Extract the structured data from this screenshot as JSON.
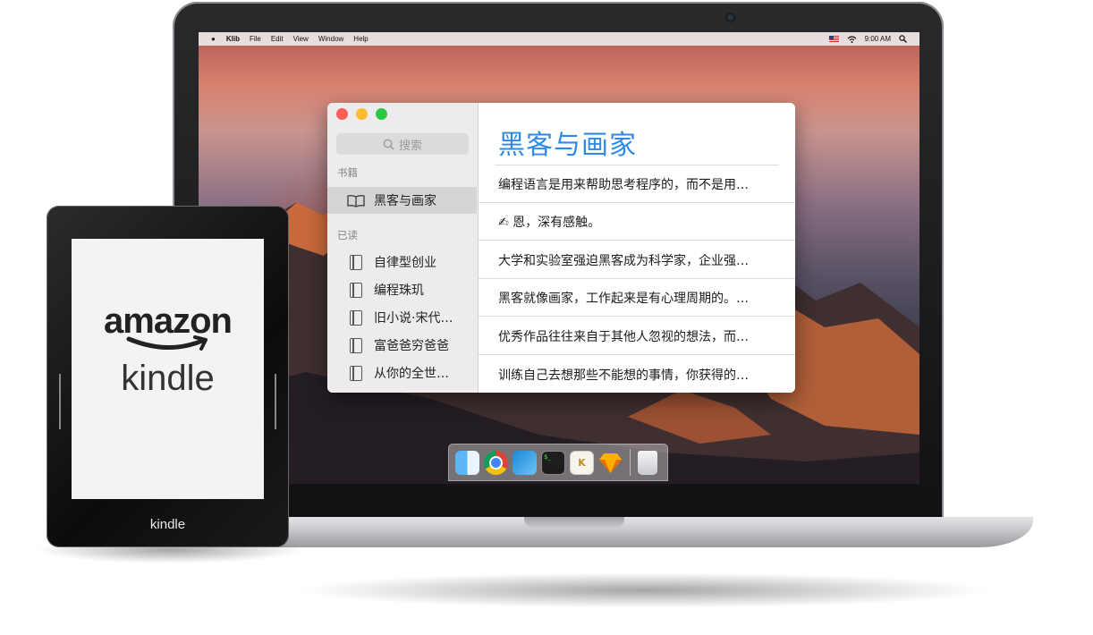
{
  "menubar": {
    "app_name": "Klib",
    "menus": [
      "File",
      "Edit",
      "View",
      "Window",
      "Help"
    ],
    "clock": "9:00 AM"
  },
  "sidebar": {
    "search_placeholder": "搜索",
    "section_books": "书籍",
    "books": [
      {
        "label": "黑客与画家",
        "selected": true
      }
    ],
    "section_read": "已读",
    "read": [
      {
        "label": "自律型创业"
      },
      {
        "label": "编程珠玑"
      },
      {
        "label": "旧小说·宋代…"
      },
      {
        "label": "富爸爸穷爸爸"
      },
      {
        "label": "从你的全世…"
      }
    ]
  },
  "content": {
    "title": "黑客与画家",
    "highlights": [
      {
        "text": "编程语言是用来帮助思考程序的，而不是用…"
      },
      {
        "text": "✍ 恩，深有感触。",
        "is_note": true
      },
      {
        "text": "大学和实验室强迫黑客成为科学家，企业强…"
      },
      {
        "text": "黑客就像画家，工作起来是有心理周期的。…"
      },
      {
        "text": "优秀作品往往来自于其他人忽视的想法，而…"
      },
      {
        "text": "训练自己去想那些不能想的事情，你获得的…"
      }
    ],
    "accent_color": "#2f8ae5"
  },
  "dock": {
    "items": [
      "finder-icon",
      "chrome-icon",
      "xcode-icon",
      "terminal-icon",
      "klib-icon",
      "sketch-icon",
      "trash-icon"
    ],
    "klib_glyph": "K",
    "terminal_glyph": "$_"
  },
  "kindle": {
    "screen_brand": "amazon",
    "screen_product": "kindle",
    "bezel_logo": "kindle"
  }
}
